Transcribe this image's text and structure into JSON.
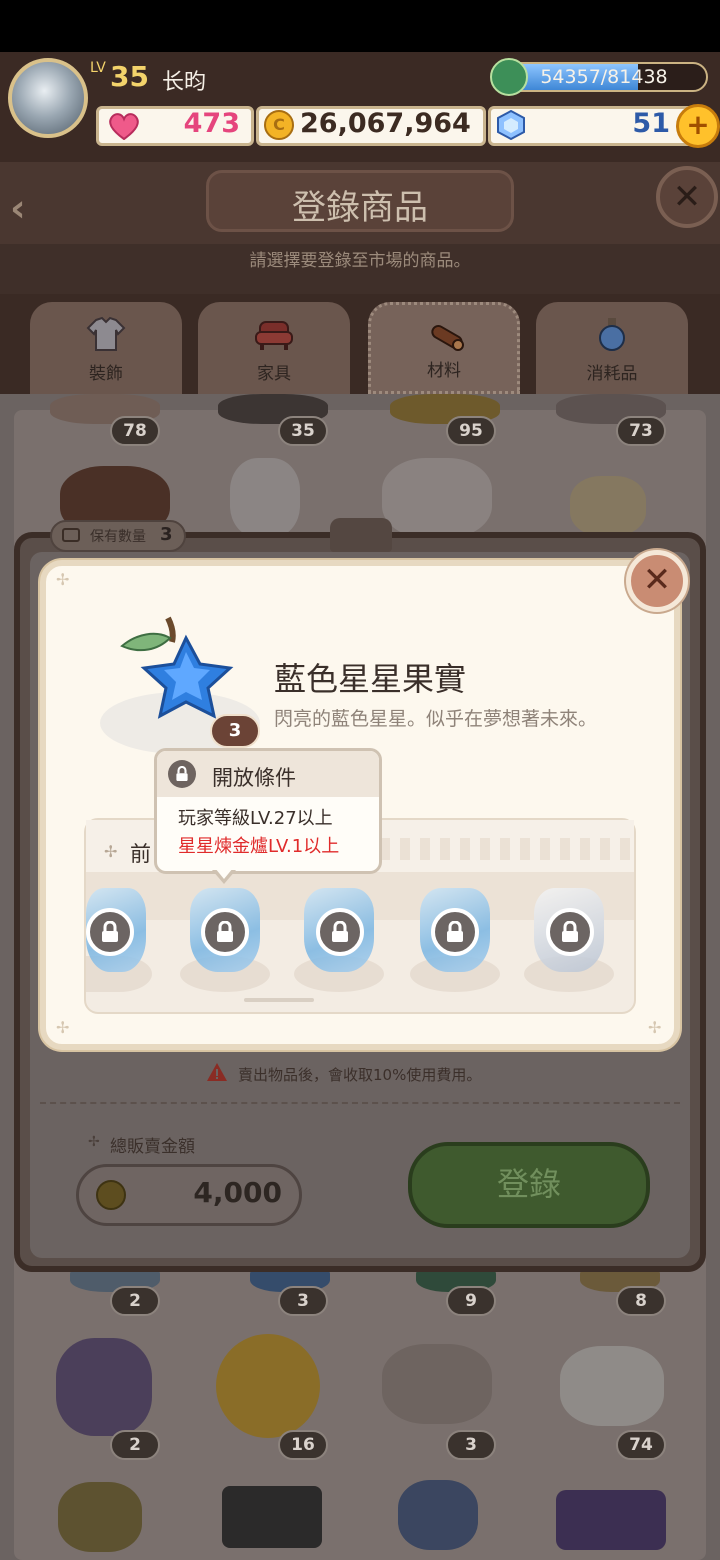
{
  "player": {
    "lv_prefix": "LV",
    "level": "35",
    "name": "长昀",
    "xp_text": "54357/81438",
    "xp_progress": 0.667
  },
  "resources": {
    "hearts": "473",
    "coins": "26,067,964",
    "gems": "51",
    "plus": "+"
  },
  "header": {
    "back": "‹",
    "title": "登錄商品",
    "close": "✕",
    "subtitle": "請選擇要登錄至市場的商品。"
  },
  "tabs": [
    {
      "label": "裝飾",
      "icon": "shirt-icon"
    },
    {
      "label": "家具",
      "icon": "sofa-icon"
    },
    {
      "label": "材料",
      "icon": "log-icon",
      "active": true
    },
    {
      "label": "消耗品",
      "icon": "potion-icon"
    }
  ],
  "grid": {
    "row1_counts": [
      "78",
      "35",
      "95",
      "73"
    ],
    "row_mid_counts": [
      "2",
      "3",
      "9",
      "8"
    ],
    "row_low_counts": [
      "2",
      "16",
      "3",
      "74"
    ]
  },
  "sell_panel": {
    "hold_label": "保有數量",
    "hold_count": "3",
    "fee_notice": "賣出物品後，會收取10%使用費用。",
    "total_label": "總販賣金額",
    "total_price": "4,000",
    "register_label": "登錄"
  },
  "modal": {
    "close": "✕",
    "item_name": "藍色星星果實",
    "item_desc": "閃亮的藍色星星。似乎在夢想著未來。",
    "item_count": "3",
    "recipe_title": "前",
    "tooltip_title": "開放條件",
    "condition_1": "玩家等級LV.27以上",
    "condition_2": "星星煉金爐LV.1以上",
    "condition_2_color": "#e02b2b"
  }
}
